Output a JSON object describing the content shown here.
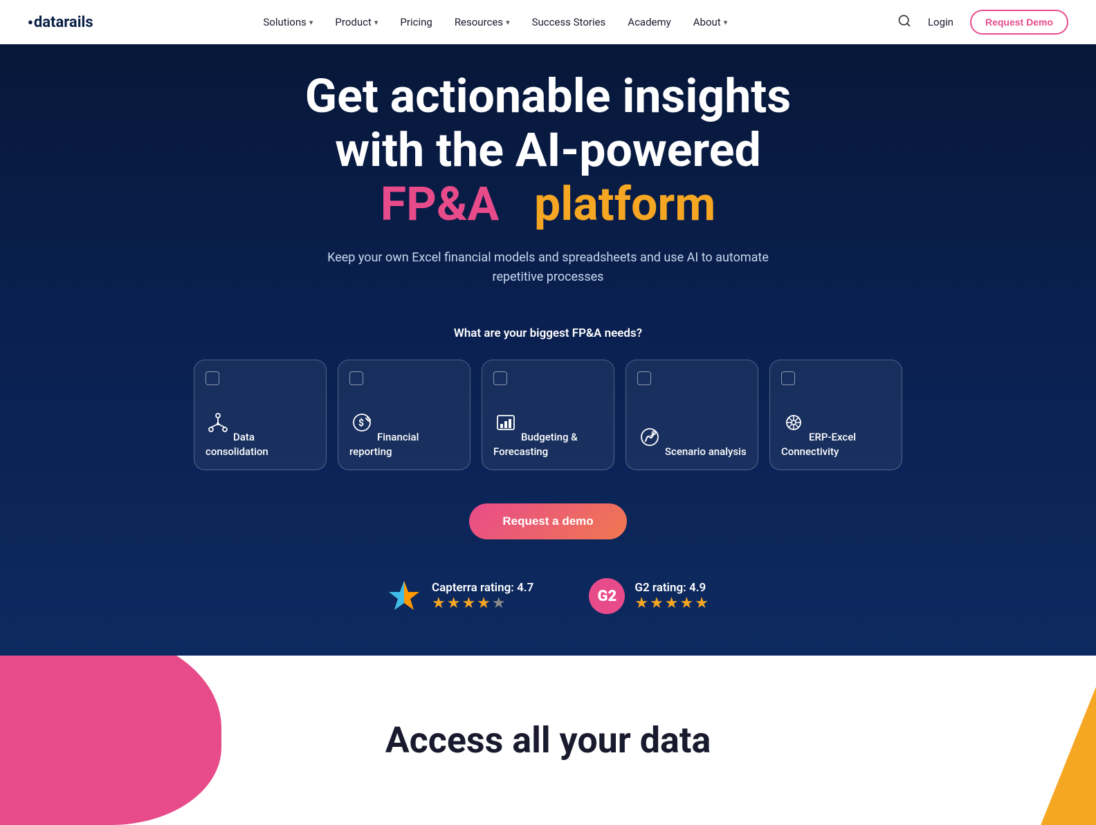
{
  "navbar": {
    "logo": "datarails",
    "links": [
      {
        "label": "Solutions",
        "has_dropdown": true
      },
      {
        "label": "Product",
        "has_dropdown": true
      },
      {
        "label": "Pricing",
        "has_dropdown": false
      },
      {
        "label": "Resources",
        "has_dropdown": true
      },
      {
        "label": "Success Stories",
        "has_dropdown": false
      },
      {
        "label": "Academy",
        "has_dropdown": false
      },
      {
        "label": "About",
        "has_dropdown": true
      }
    ],
    "login_label": "Login",
    "demo_label": "Request Demo"
  },
  "hero": {
    "title_line1": "Get actionable insights",
    "title_line2": "with the AI-powered",
    "title_fpa": "FP&A",
    "title_platform": "platform",
    "subtitle": "Keep your own Excel financial models and spreadsheets and use AI to automate repetitive processes",
    "question": "What are your biggest FP&A needs?",
    "demo_button": "Request a demo"
  },
  "cards": [
    {
      "id": "data-consolidation",
      "label": "Data consolidation",
      "icon": "consolidation"
    },
    {
      "id": "financial-reporting",
      "label": "Financial reporting",
      "icon": "reporting"
    },
    {
      "id": "budgeting-forecasting",
      "label": "Budgeting & Forecasting",
      "icon": "budgeting"
    },
    {
      "id": "scenario-analysis",
      "label": "Scenario analysis",
      "icon": "scenario"
    },
    {
      "id": "erp-excel",
      "label": "ERP-Excel Connectivity",
      "icon": "erp"
    }
  ],
  "ratings": [
    {
      "id": "capterra",
      "name": "Capterra rating: 4.7",
      "stars": "★★★★½",
      "star_count": 4.7
    },
    {
      "id": "g2",
      "name": "G2 rating: 4.9",
      "stars": "★★★★★",
      "star_count": 4.9
    }
  ],
  "lower": {
    "title": "Access all your data"
  },
  "colors": {
    "pink": "#e84b8a",
    "orange": "#f5a623",
    "navy": "#061635",
    "white": "#ffffff"
  }
}
